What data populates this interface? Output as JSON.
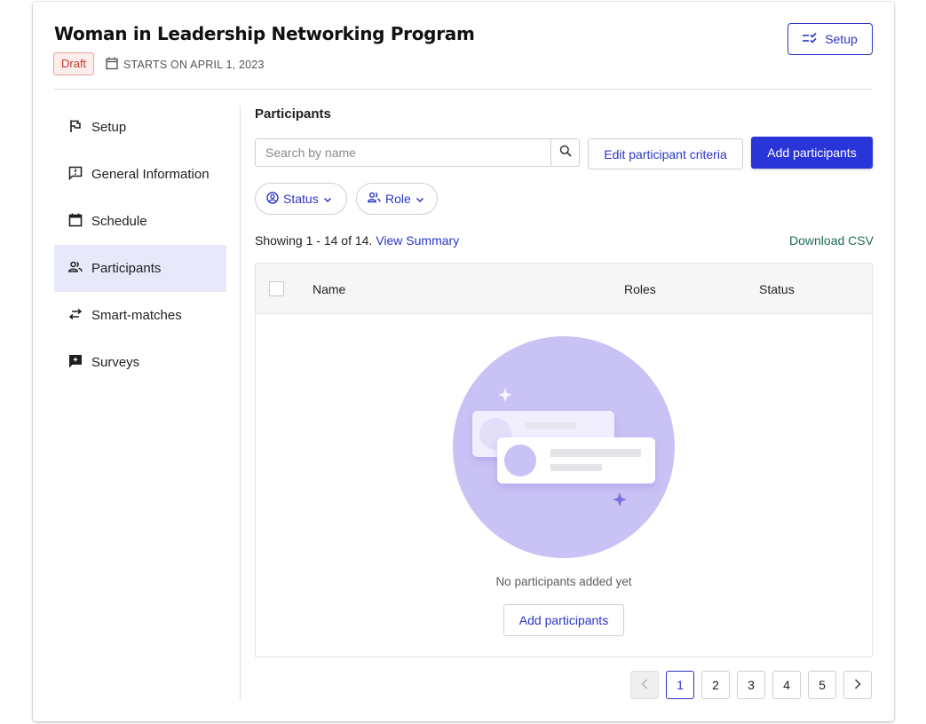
{
  "header": {
    "title": "Woman in Leadership Networking Program",
    "badge": "Draft",
    "start_text": "STARTS ON APRIL 1, 2023",
    "setup_button": "Setup"
  },
  "sidebar": {
    "items": [
      {
        "label": "Setup",
        "icon": "flag-icon"
      },
      {
        "label": "General Information",
        "icon": "info-chat-icon"
      },
      {
        "label": "Schedule",
        "icon": "calendar-icon"
      },
      {
        "label": "Participants",
        "icon": "people-icon",
        "active": true
      },
      {
        "label": "Smart-matches",
        "icon": "swap-arrows-icon"
      },
      {
        "label": "Surveys",
        "icon": "feedback-icon"
      }
    ]
  },
  "main": {
    "title": "Participants",
    "search_placeholder": "Search by name",
    "edit_criteria_button": "Edit participant criteria",
    "add_participants_button": "Add participants",
    "filters": {
      "status": "Status",
      "role": "Role"
    },
    "showing_text": "Showing 1 - 14 of 14.",
    "view_summary": "View Summary",
    "download_csv": "Download CSV",
    "table": {
      "columns": [
        "Name",
        "Roles",
        "Status"
      ],
      "empty_message": "No participants added yet",
      "empty_add_button": "Add participants"
    },
    "pagination": {
      "pages": [
        "1",
        "2",
        "3",
        "4",
        "5"
      ],
      "current": "1"
    }
  },
  "colors": {
    "accent": "#2a35d9",
    "active_nav_bg": "#e8e8fb",
    "draft_text": "#c0392b",
    "download_link": "#1c6b5a",
    "illustration_circle": "#c9c2f5"
  }
}
